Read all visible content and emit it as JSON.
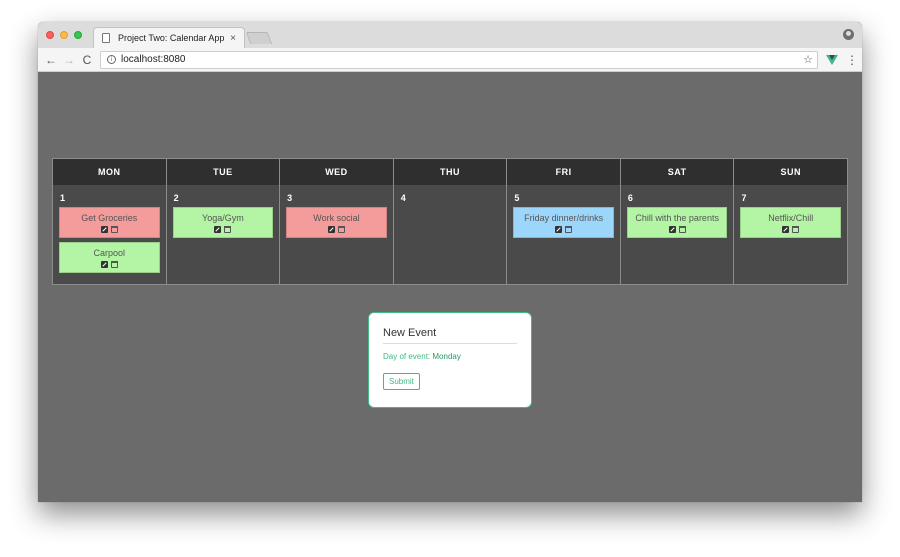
{
  "browser": {
    "tab_title": "Project Two: Calendar App",
    "tab_close": "×",
    "url": "localhost:8080",
    "nav": {
      "back": "←",
      "forward": "→",
      "reload": "C",
      "info": "i",
      "star": "☆",
      "menu": "⋮"
    }
  },
  "calendar": {
    "days": [
      {
        "name": "MON",
        "num": "1",
        "events": [
          {
            "title": "Get Groceries",
            "color": "#f49b9b"
          },
          {
            "title": "Carpool",
            "color": "#b3f5a4"
          }
        ]
      },
      {
        "name": "TUE",
        "num": "2",
        "events": [
          {
            "title": "Yoga/Gym",
            "color": "#b3f5a4"
          }
        ]
      },
      {
        "name": "WED",
        "num": "3",
        "events": [
          {
            "title": "Work social",
            "color": "#f49b9b"
          }
        ]
      },
      {
        "name": "THU",
        "num": "4",
        "events": []
      },
      {
        "name": "FRI",
        "num": "5",
        "events": [
          {
            "title": "Friday dinner/drinks",
            "color": "#9cd6fb"
          }
        ]
      },
      {
        "name": "SAT",
        "num": "6",
        "events": [
          {
            "title": "Chill with the parents",
            "color": "#b3f5a4"
          }
        ]
      },
      {
        "name": "SUN",
        "num": "7",
        "events": [
          {
            "title": "Netflix/Chill",
            "color": "#b3f5a4"
          }
        ]
      }
    ]
  },
  "new_event": {
    "placeholder": "New Event",
    "day_label": "Day of event:",
    "day_value": "Monday",
    "submit_label": "Submit"
  },
  "colors": {
    "accent": "#42b983",
    "header_bg": "#2f2f2f",
    "cell_bg": "#4a4a4a",
    "page_bg": "#6b6b6b"
  }
}
